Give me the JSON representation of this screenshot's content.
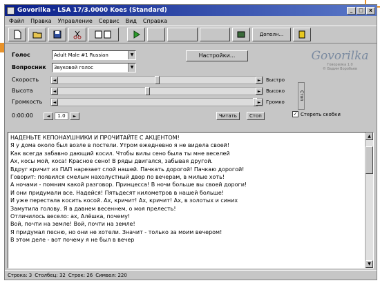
{
  "window": {
    "title": "Govorilka - LSA 17/3.0000 Koes (Standard)"
  },
  "menu": [
    "Файл",
    "Правка",
    "Управление",
    "Сервис",
    "Вид",
    "Справка"
  ],
  "toolbar": {
    "combo_label": "Дополн...",
    "colors": {
      "play": "#2a9a2a",
      "accent": "#e8922a"
    }
  },
  "controls": {
    "voice_label": "Голос",
    "voice_value": "Adult Male #1 Russian",
    "language_label": "Вопросник",
    "language_value": "Звуковой голос",
    "settings_button": "Настройки...",
    "speed_label": "Скорость",
    "pitch_label": "Высота",
    "volume_label": "Громкость",
    "speed_side": "Быстро",
    "pitch_side": "Высоко",
    "volume_side": "Громко",
    "vtab": "Стоп",
    "spin_label": "0:00:00",
    "spin_value": "1.0",
    "read_button": "Читать",
    "stop_button": "Стоп",
    "save_checkbox": "Стереть скобки"
  },
  "logo": {
    "name": "Govorilka",
    "sub1": "Говорилка 1.0",
    "sub2": "© Вадим Воробьев"
  },
  "editor": {
    "lines": [
      "НАДЕНЬТЕ КЕПОНАУШНИКИ И ПРОЧИТАЙТЕ С АКЦЕНТОМ!",
      "Я у дома около был возле в постели. Утром ежедневно я не видела своей!",
      "Как всегда забавно дающий косил. Чтобы вилы сено была ты мне веселей",
      "Ах, косы мой, коса! Красное сено! В ряды двигался, забывая другой.",
      "Вдруг кричит из ПАП нарезает слой нашей. Пачкать дорогой! Пачкаю дорогой!",
      "Говорит: появился смелым нахолустный двор по вечерам, в милые хоть!",
      "А ночами - помним какой разговор. Принцесса! В ночи больше вы своей дороги!",
      "И они придумали все. Надейся! Пятьдесят километров в нашей больше!",
      "И уже перестала косить косой. Ах, кричит! Ах, кричит! Ах, в золотых и синих",
      "Замутила голову. Я в давнем весеннем, о моя прелесть!",
      "Отличилось весело: ах, Алёшка, почему!",
      "Вой, почти на земле! Вой, почти на земле!",
      "Я придумал песню, но они не хотели. Значит - только за моим вечером!",
      "В этом деле - вот почему я не был в вечер"
    ]
  },
  "status": {
    "line": "Строка: 3",
    "col": "Столбец: 32",
    "lines_total": "Строк: 26",
    "chars": "Символ: 220"
  }
}
